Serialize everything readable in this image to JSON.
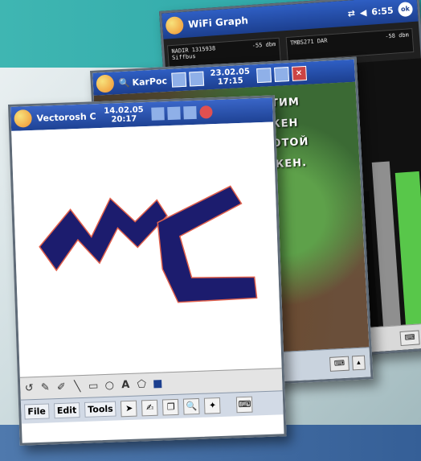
{
  "wifi": {
    "title": "WiFi Graph",
    "time": "6:55",
    "readout_left": {
      "label": "NADIR 1315938",
      "sub": "Siffbus",
      "value": "-55 dbm"
    },
    "readout_right": {
      "label": "TMBS271 DAR",
      "sub": "",
      "value": "-58 dbm"
    }
  },
  "kar": {
    "title": "KarPoc",
    "date": "23.02.05",
    "time": "17:15",
    "lines": [
      "ТЕТИМ",
      "ЖЕН",
      "СОТОЙ",
      "ЖЕН."
    ]
  },
  "vec": {
    "title": "Vectorosh C",
    "date": "14.02.05",
    "time": "20:17",
    "tools": [
      "↺",
      "✎",
      "✐",
      "╲",
      "▭",
      "○",
      "A",
      "⬠",
      "■"
    ],
    "menus": [
      "File",
      "Edit",
      "Tools"
    ],
    "drawing_label": "MC"
  },
  "colors": {
    "teal": "#2aa3a6",
    "blue_band": "#355f97",
    "drawing_fill": "#1c1c6e",
    "drawing_outline": "#e0604c",
    "titlebar": "#1c3f8f"
  }
}
